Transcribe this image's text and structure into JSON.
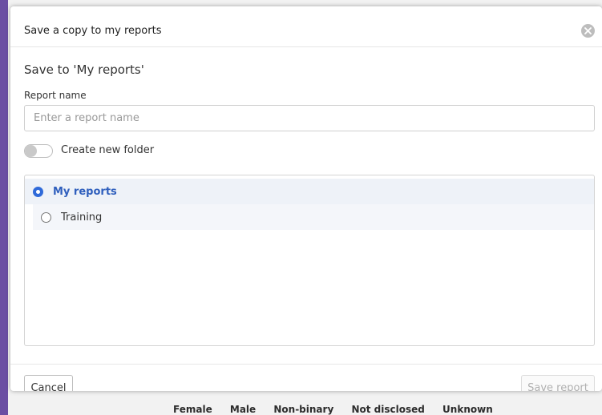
{
  "dialog": {
    "title": "Save a copy to my reports",
    "subtitle": "Save to 'My reports'",
    "close_icon": "close-icon"
  },
  "form": {
    "report_name_label": "Report name",
    "report_name_value": "",
    "report_name_placeholder": "Enter a report name",
    "create_folder_label": "Create new folder",
    "create_folder_enabled": false
  },
  "folders": [
    {
      "label": "My reports",
      "selected": true
    },
    {
      "label": "Training",
      "selected": false
    }
  ],
  "footer": {
    "cancel_label": "Cancel",
    "save_label": "Save report",
    "save_disabled": true
  },
  "background": {
    "legend_items": [
      "Female",
      "Male",
      "Non-binary",
      "Not disclosed",
      "Unknown"
    ]
  },
  "colors": {
    "accent": "#2f6ad9",
    "frame": "#6b4fa3"
  }
}
